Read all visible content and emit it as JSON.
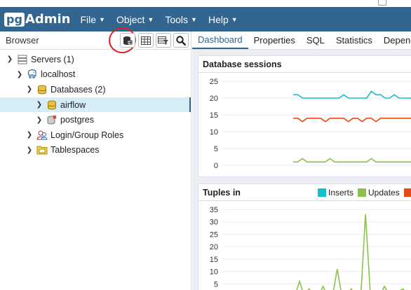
{
  "app": {
    "brand_short": "pg",
    "brand_rest": "Admin",
    "menu": [
      {
        "label": "File"
      },
      {
        "label": "Object"
      },
      {
        "label": "Tools"
      },
      {
        "label": "Help"
      }
    ]
  },
  "colors": {
    "navbar": "#326690",
    "inserts": "#17becf",
    "updates": "#8bc34a",
    "deletes": "#e64a19",
    "annotation": "#e0201c"
  },
  "browser": {
    "title": "Browser",
    "toolbar_icons": [
      "query-tool-icon",
      "table-grid-icon",
      "filter-table-icon",
      "search-icon"
    ],
    "tree": [
      {
        "label": "Servers (1)",
        "icon": "servers-icon",
        "toggle": "expanded"
      },
      {
        "label": "localhost",
        "icon": "elephant-server-icon",
        "toggle": "expanded"
      },
      {
        "label": "Databases (2)",
        "icon": "databases-icon",
        "toggle": "expanded"
      },
      {
        "label": "airflow",
        "icon": "database-icon",
        "toggle": "collapsed",
        "selected": true
      },
      {
        "label": "postgres",
        "icon": "database-disconnected-icon",
        "toggle": "collapsed"
      },
      {
        "label": "Login/Group Roles",
        "icon": "roles-icon",
        "toggle": "collapsed"
      },
      {
        "label": "Tablespaces",
        "icon": "tablespaces-icon",
        "toggle": "collapsed"
      }
    ]
  },
  "tabs": [
    {
      "label": "Dashboard",
      "active": true
    },
    {
      "label": "Properties"
    },
    {
      "label": "SQL"
    },
    {
      "label": "Statistics"
    },
    {
      "label": "Depend"
    }
  ],
  "chart_data": [
    {
      "type": "line",
      "title": "Database sessions",
      "ylim": [
        0,
        25
      ],
      "yticks": [
        "25",
        "20",
        "15",
        "10",
        "5",
        "0"
      ],
      "series": [
        {
          "color": "#17becf",
          "values": [
            21,
            21,
            20,
            20,
            20,
            20,
            20,
            20,
            20,
            20,
            20,
            21,
            20,
            20,
            20,
            20,
            20,
            22,
            21,
            21,
            20,
            20,
            21,
            20,
            20,
            20,
            20,
            20
          ]
        },
        {
          "color": "#e64a19",
          "values": [
            14,
            14,
            13,
            14,
            14,
            14,
            14,
            13,
            14,
            14,
            14,
            14,
            13,
            14,
            14,
            13,
            14,
            14,
            13,
            14,
            14,
            14,
            14,
            14,
            14,
            14,
            14,
            14
          ]
        },
        {
          "color": "#8bc34a",
          "values": [
            1,
            1,
            2,
            1,
            1,
            1,
            1,
            1,
            2,
            1,
            1,
            1,
            1,
            1,
            1,
            1,
            1,
            2,
            1,
            1,
            1,
            1,
            1,
            1,
            1,
            1,
            1,
            1
          ]
        }
      ]
    },
    {
      "type": "line",
      "title": "Tuples in",
      "ylim": [
        0,
        35
      ],
      "yticks": [
        "35",
        "30",
        "25",
        "20",
        "15",
        "10",
        "5"
      ],
      "legend": [
        "Inserts",
        "Updates"
      ],
      "series": [
        {
          "name": "Updates",
          "color": "#8bc34a",
          "values": [
            0,
            0,
            0,
            0,
            0,
            0,
            0,
            0,
            0,
            1,
            0,
            0,
            2,
            0,
            6,
            0,
            3,
            1,
            0,
            4,
            0,
            0,
            11,
            0,
            1,
            3,
            0,
            0,
            33,
            2,
            0,
            0,
            4,
            1,
            0,
            2,
            3,
            0,
            1,
            0
          ]
        }
      ]
    }
  ]
}
